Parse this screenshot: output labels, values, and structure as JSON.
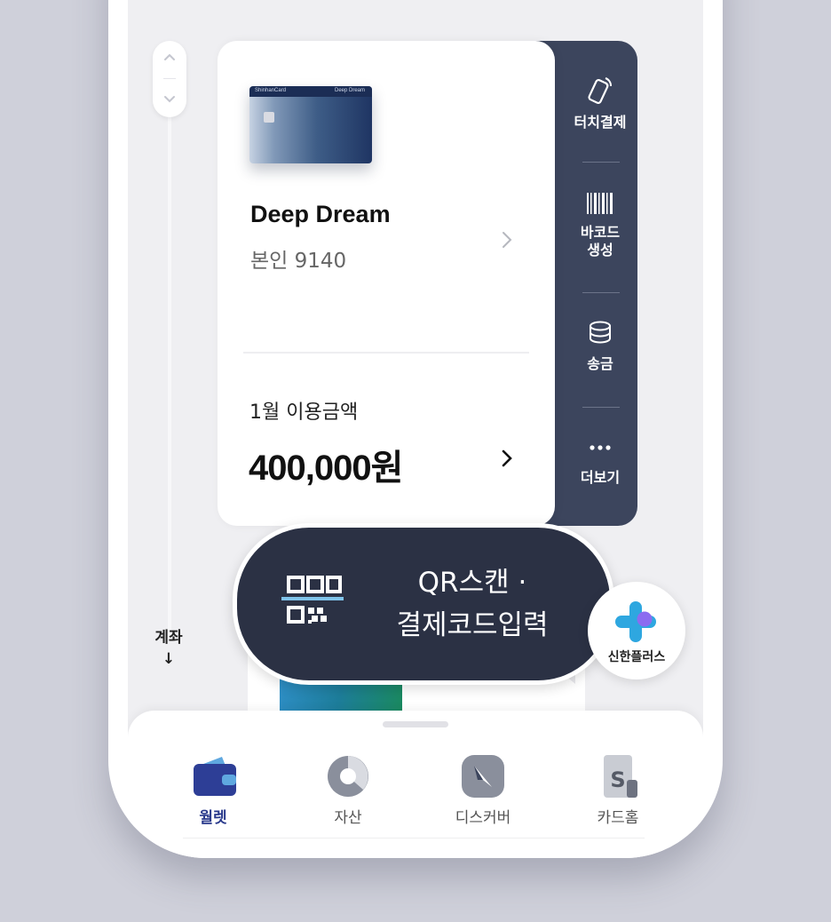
{
  "scroll": {
    "up_label": "up",
    "down_label": "down"
  },
  "account_section": {
    "label": "계좌",
    "arrow": "↓"
  },
  "card": {
    "brand_left": "ShinhanCard",
    "brand_right": "Deep Dream",
    "name": "Deep Dream",
    "owner": "본인 9140",
    "usage_label": "1월 이용금액",
    "usage_amount": "400,000원"
  },
  "actions": [
    {
      "label": "터치결제",
      "icon": "touch-pay-icon"
    },
    {
      "label": "바코드\n생성",
      "icon": "barcode-icon"
    },
    {
      "label": "송금",
      "icon": "coins-icon"
    },
    {
      "label": "더보기",
      "icon": "more-dots-icon"
    }
  ],
  "qr": {
    "line1": "QR스캔 ·",
    "line2": "결제코드입력"
  },
  "shinhan_plus": {
    "label": "신한플러스"
  },
  "nav": {
    "wallet": "월렛",
    "assets": "자산",
    "discover": "디스커버",
    "card_home": "카드홈",
    "active": "wallet"
  },
  "colors": {
    "panel_dark": "#3c455d",
    "qr_bg": "#2b3144",
    "active_nav": "#2a3a8c",
    "plus_blue": "#2ea7e0",
    "plus_purple": "#8b6cf0"
  }
}
